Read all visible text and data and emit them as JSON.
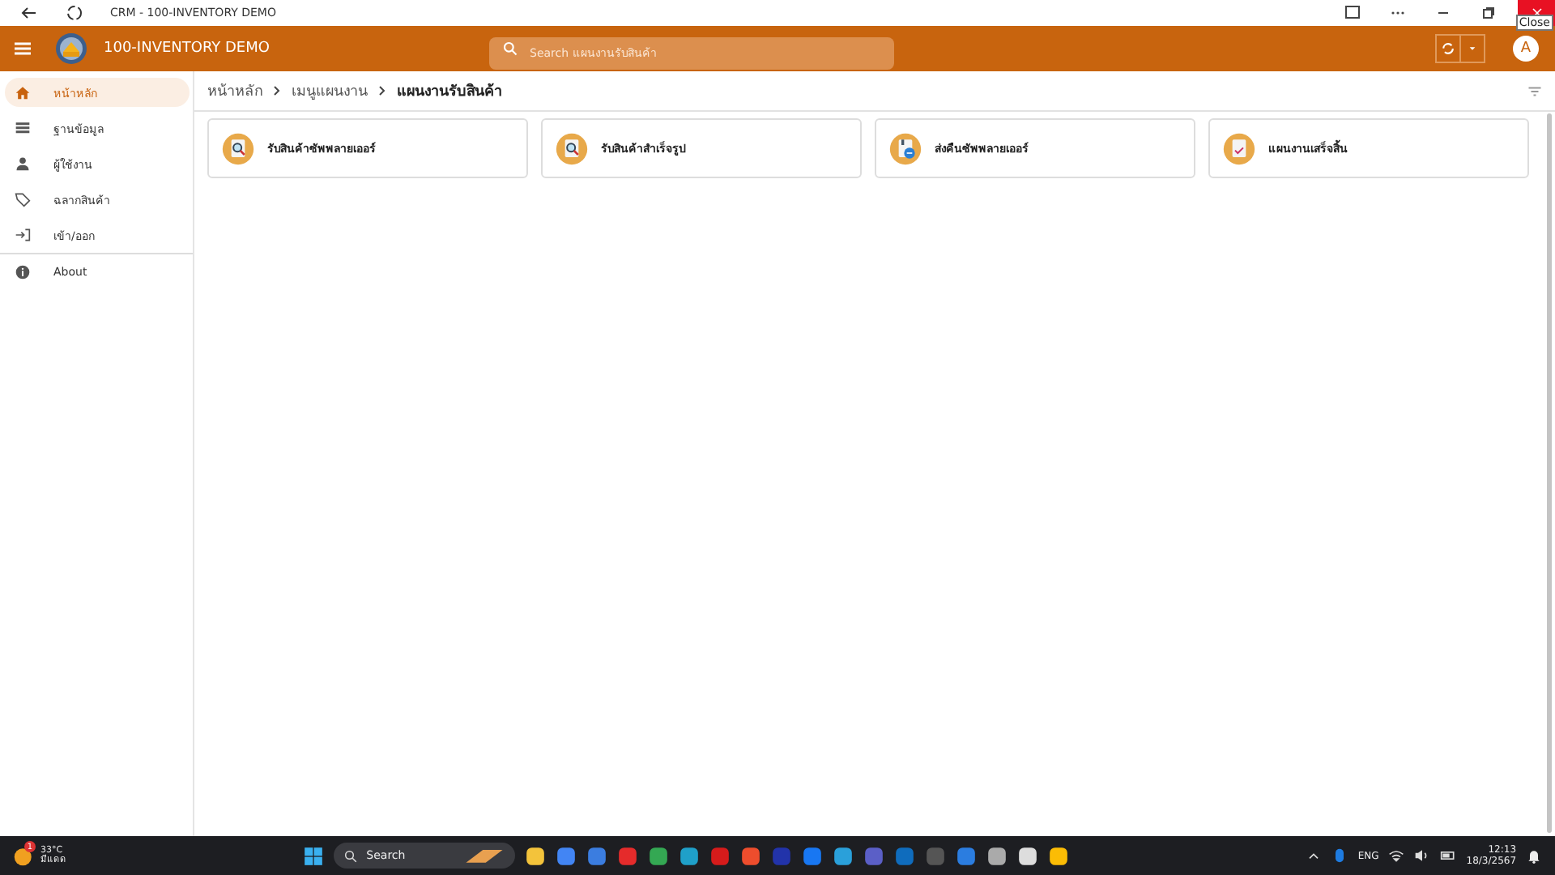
{
  "browser": {
    "title": "CRM - 100-INVENTORY DEMO",
    "tooltip": "Close"
  },
  "header": {
    "app_name": "100-INVENTORY DEMO",
    "search": {
      "placeholder": "Search แผนงานรับสินค้า"
    },
    "avatar": "A"
  },
  "sidebar": {
    "items": [
      {
        "label": "หน้าหลัก",
        "kind": "home",
        "selected": true
      },
      {
        "label": "ฐานข้อมูล",
        "kind": "list",
        "selected": false
      },
      {
        "label": "ผู้ใช้งาน",
        "kind": "user",
        "selected": false
      },
      {
        "label": "ฉลากสินค้า",
        "kind": "tag",
        "selected": false
      },
      {
        "label": "เข้า/ออก",
        "kind": "login",
        "selected": false
      },
      {
        "label": "About",
        "kind": "info",
        "selected": false
      }
    ]
  },
  "breadcrumb": [
    "หน้าหลัก",
    "เมนูแผนงาน",
    "แผนงานรับสินค้า"
  ],
  "cards": [
    {
      "label": "รับสินค้าซัพพลายเออร์",
      "kind": "search"
    },
    {
      "label": "รับสินค้าสำเร็จรูป",
      "kind": "search"
    },
    {
      "label": "ส่งคืนซัพพลายเออร์",
      "kind": "return"
    },
    {
      "label": "แผนงานเสร็จสิ้น",
      "kind": "done"
    }
  ],
  "taskbar": {
    "weather": {
      "temp": "33°C",
      "condition": "มีแดด",
      "badge": "1"
    },
    "search": "Search",
    "language": "ENG",
    "time": "12:13",
    "date": "18/3/2567"
  }
}
